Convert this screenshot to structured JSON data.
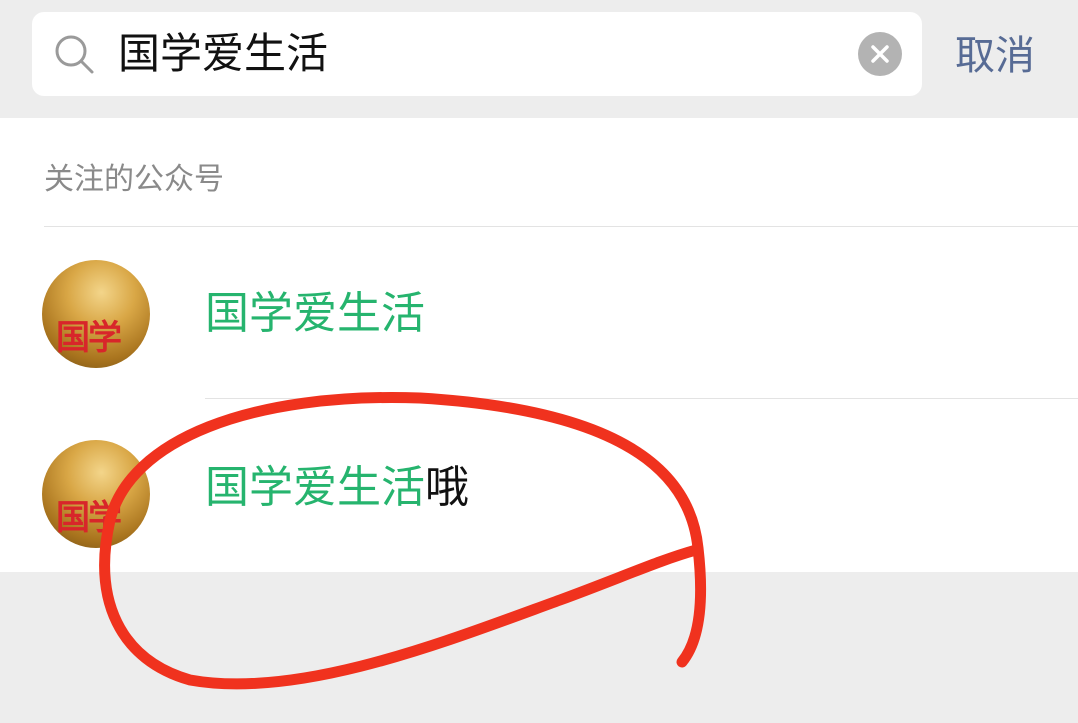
{
  "search": {
    "query": "国学爱生活",
    "cancel_label": "取消"
  },
  "section": {
    "title": "关注的公众号"
  },
  "results": [
    {
      "avatar_text": "国学",
      "name_highlight": "国学爱生活",
      "name_rest": ""
    },
    {
      "avatar_text": "国学",
      "name_highlight": "国学爱生活",
      "name_rest": "哦"
    }
  ],
  "colors": {
    "highlight": "#26b46e",
    "cancel": "#576b95",
    "annotation": "#f0321e"
  }
}
